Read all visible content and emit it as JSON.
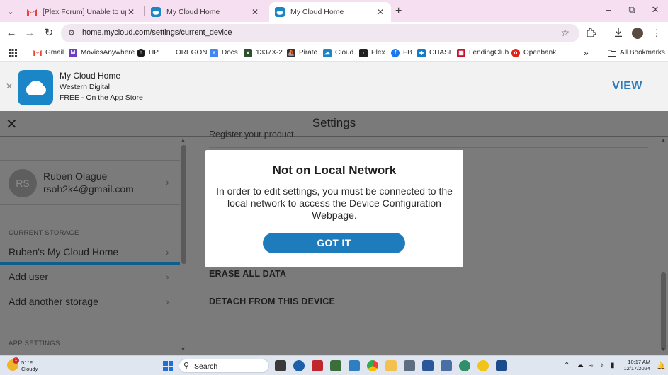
{
  "browser": {
    "tabs": [
      {
        "title": "[Plex Forum] Unable to upload",
        "favicon": "gmail-icon",
        "active": false
      },
      {
        "title": "My Cloud Home",
        "favicon": "mycloud-icon",
        "active": false
      },
      {
        "title": "My Cloud Home",
        "favicon": "mycloud-icon",
        "active": true
      }
    ],
    "url": "home.mycloud.com/settings/current_device",
    "bookmarks": [
      {
        "label": "Gmail",
        "icon": "gmail-icon",
        "color": "#ea4335"
      },
      {
        "label": "MoviesAnywhere",
        "icon": "movies-anywhere-icon",
        "color": "#6b3fbf"
      },
      {
        "label": "HP",
        "icon": "hp-icon",
        "color": "#1a1a1a"
      },
      {
        "label": "OREGON",
        "icon": "",
        "color": ""
      },
      {
        "label": "Docs",
        "icon": "docs-icon",
        "color": "#4285f4"
      },
      {
        "label": "1337X-2",
        "icon": "1337x-icon",
        "color": "#2f4f2f"
      },
      {
        "label": "Pirate",
        "icon": "pirate-icon",
        "color": "#333333"
      },
      {
        "label": "Cloud",
        "icon": "cloud-icon",
        "color": "#1b86c7"
      },
      {
        "label": "Plex",
        "icon": "plex-icon",
        "color": "#e5a00d"
      },
      {
        "label": "FB",
        "icon": "facebook-icon",
        "color": "#1877f2"
      },
      {
        "label": "CHASE",
        "icon": "chase-icon",
        "color": "#117aca"
      },
      {
        "label": "LendingClub",
        "icon": "lendingclub-icon",
        "color": "#c8102e"
      },
      {
        "label": "Openbank",
        "icon": "openbank-icon",
        "color": "#e2231a"
      }
    ],
    "all_bookmarks_label": "All Bookmarks"
  },
  "banner": {
    "app_title": "My Cloud Home",
    "vendor": "Western Digital",
    "price": "FREE - On the App Store",
    "view_label": "VIEW"
  },
  "settings": {
    "title": "Settings",
    "partial_top_text": "Register your product",
    "user": {
      "initials": "RS",
      "name": "Ruben Olague",
      "email": "rsoh2k4@gmail.com"
    },
    "current_storage_label": "CURRENT STORAGE",
    "storage_items": [
      "Ruben's My Cloud Home",
      "Add user",
      "Add another storage"
    ],
    "app_settings_label": "APP SETTINGS",
    "actions": [
      "ERASE ALL DATA",
      "DETACH FROM THIS DEVICE"
    ]
  },
  "modal": {
    "title": "Not on Local Network",
    "body": "In order to edit settings, you must be connected to the local network to access the Device Configuration Webpage.",
    "button_label": "GOT IT"
  },
  "taskbar": {
    "weather_temp": "51°F",
    "weather_cond": "Cloudy",
    "weather_badge": "1",
    "search_label": "Search",
    "time": "10:17 AM",
    "date": "12/17/2024"
  },
  "colors": {
    "accent": "#1e7cbd",
    "tab_strip": "#f6dff0",
    "overlay_gray": "#7b7b7b",
    "view_link": "#2b7bbd"
  }
}
